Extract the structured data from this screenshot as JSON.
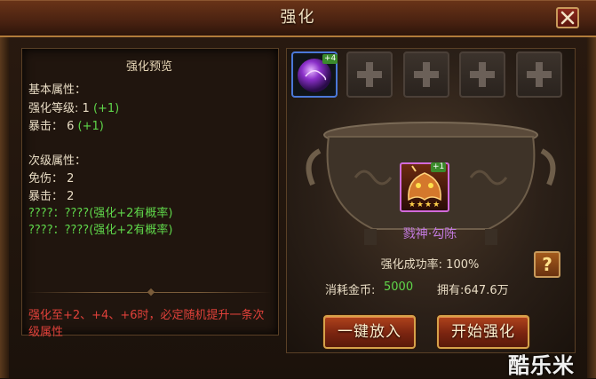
{
  "window": {
    "title": "强化"
  },
  "preview": {
    "title": "强化预览",
    "basic_header": "基本属性：",
    "basic": [
      {
        "label": "强化等级: 1",
        "bonus": "(+1)"
      },
      {
        "label": "暴击： 6",
        "bonus": "(+1)"
      }
    ],
    "secondary_header": "次级属性：",
    "secondary": [
      {
        "label": "免伤： 2"
      },
      {
        "label": "暴击： 2"
      },
      {
        "label": "????：????(强化+2有概率)",
        "green": true
      },
      {
        "label": "????：????(强化+2有概率)",
        "green": true
      }
    ],
    "note": "强化至+2、+4、+6时，必定随机提升一条次级属性"
  },
  "material_slots": {
    "item_badge": "+4",
    "empty_count": 4
  },
  "hero": {
    "badge": "+1",
    "stars": "★★★★",
    "name": "戮神·勾陈"
  },
  "stats": {
    "success_rate": "强化成功率: 100%",
    "cost_label": "消耗金币:",
    "cost_value": "5000",
    "owned": "拥有:647.6万"
  },
  "buttons": {
    "auto_fill": "一键放入",
    "start": "开始强化",
    "help": "?"
  },
  "watermark": "酷乐米",
  "colors": {
    "green_text": "#5fd64a",
    "red_text": "#e0413a",
    "hero_name": "#c37ae0",
    "button_border": "#d6a24a"
  }
}
